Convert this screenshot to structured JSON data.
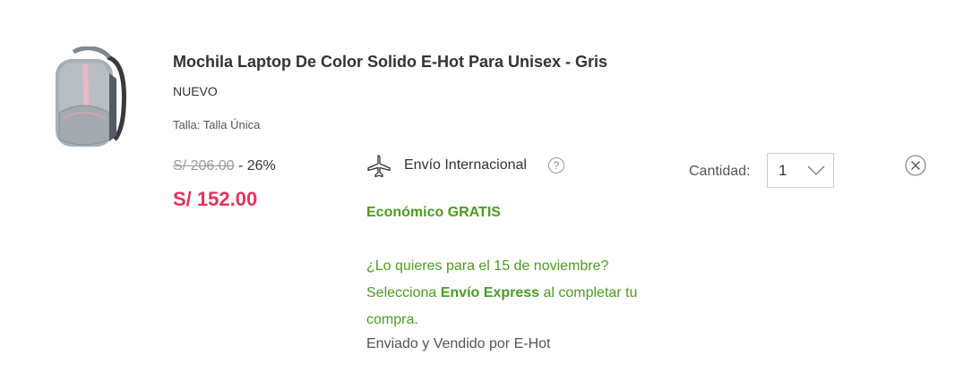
{
  "product": {
    "title": "Mochila Laptop De Color Solido E-Hot Para Unisex - Gris",
    "condition": "NUEVO",
    "size": "Talla: Talla Única",
    "old_price": "S/ 206.00",
    "discount": "- 26%",
    "price": "S/ 152.00",
    "image_icon": "backpack-image"
  },
  "shipping": {
    "label": "Envío Internacional",
    "help": "?",
    "economy": "Económico GRATIS",
    "express_prefix": "¿Lo quieres para el 15 de noviembre? Selecciona",
    "express_bold": "Envío Express",
    "express_suffix": "al completar tu compra.",
    "seller": "Enviado y Vendido por E-Hot",
    "icon": "airplane-icon"
  },
  "quantity": {
    "label": "Cantidad:",
    "value": "1"
  },
  "colors": {
    "price": "#e4335b",
    "green": "#4a9d1f"
  }
}
